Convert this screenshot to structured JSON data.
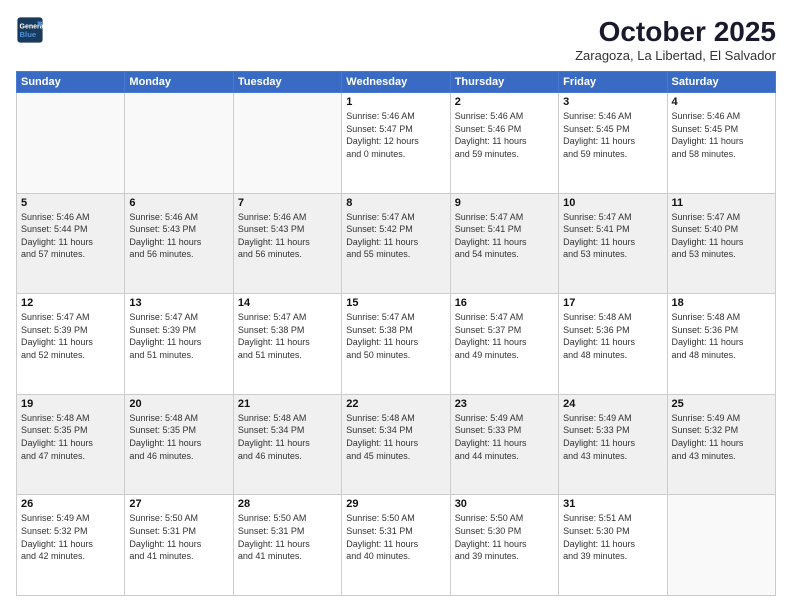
{
  "header": {
    "logo_line1": "General",
    "logo_line2": "Blue",
    "month": "October 2025",
    "location": "Zaragoza, La Libertad, El Salvador"
  },
  "weekdays": [
    "Sunday",
    "Monday",
    "Tuesday",
    "Wednesday",
    "Thursday",
    "Friday",
    "Saturday"
  ],
  "weeks": [
    [
      {
        "day": "",
        "info": ""
      },
      {
        "day": "",
        "info": ""
      },
      {
        "day": "",
        "info": ""
      },
      {
        "day": "1",
        "info": "Sunrise: 5:46 AM\nSunset: 5:47 PM\nDaylight: 12 hours\nand 0 minutes."
      },
      {
        "day": "2",
        "info": "Sunrise: 5:46 AM\nSunset: 5:46 PM\nDaylight: 11 hours\nand 59 minutes."
      },
      {
        "day": "3",
        "info": "Sunrise: 5:46 AM\nSunset: 5:45 PM\nDaylight: 11 hours\nand 59 minutes."
      },
      {
        "day": "4",
        "info": "Sunrise: 5:46 AM\nSunset: 5:45 PM\nDaylight: 11 hours\nand 58 minutes."
      }
    ],
    [
      {
        "day": "5",
        "info": "Sunrise: 5:46 AM\nSunset: 5:44 PM\nDaylight: 11 hours\nand 57 minutes."
      },
      {
        "day": "6",
        "info": "Sunrise: 5:46 AM\nSunset: 5:43 PM\nDaylight: 11 hours\nand 56 minutes."
      },
      {
        "day": "7",
        "info": "Sunrise: 5:46 AM\nSunset: 5:43 PM\nDaylight: 11 hours\nand 56 minutes."
      },
      {
        "day": "8",
        "info": "Sunrise: 5:47 AM\nSunset: 5:42 PM\nDaylight: 11 hours\nand 55 minutes."
      },
      {
        "day": "9",
        "info": "Sunrise: 5:47 AM\nSunset: 5:41 PM\nDaylight: 11 hours\nand 54 minutes."
      },
      {
        "day": "10",
        "info": "Sunrise: 5:47 AM\nSunset: 5:41 PM\nDaylight: 11 hours\nand 53 minutes."
      },
      {
        "day": "11",
        "info": "Sunrise: 5:47 AM\nSunset: 5:40 PM\nDaylight: 11 hours\nand 53 minutes."
      }
    ],
    [
      {
        "day": "12",
        "info": "Sunrise: 5:47 AM\nSunset: 5:39 PM\nDaylight: 11 hours\nand 52 minutes."
      },
      {
        "day": "13",
        "info": "Sunrise: 5:47 AM\nSunset: 5:39 PM\nDaylight: 11 hours\nand 51 minutes."
      },
      {
        "day": "14",
        "info": "Sunrise: 5:47 AM\nSunset: 5:38 PM\nDaylight: 11 hours\nand 51 minutes."
      },
      {
        "day": "15",
        "info": "Sunrise: 5:47 AM\nSunset: 5:38 PM\nDaylight: 11 hours\nand 50 minutes."
      },
      {
        "day": "16",
        "info": "Sunrise: 5:47 AM\nSunset: 5:37 PM\nDaylight: 11 hours\nand 49 minutes."
      },
      {
        "day": "17",
        "info": "Sunrise: 5:48 AM\nSunset: 5:36 PM\nDaylight: 11 hours\nand 48 minutes."
      },
      {
        "day": "18",
        "info": "Sunrise: 5:48 AM\nSunset: 5:36 PM\nDaylight: 11 hours\nand 48 minutes."
      }
    ],
    [
      {
        "day": "19",
        "info": "Sunrise: 5:48 AM\nSunset: 5:35 PM\nDaylight: 11 hours\nand 47 minutes."
      },
      {
        "day": "20",
        "info": "Sunrise: 5:48 AM\nSunset: 5:35 PM\nDaylight: 11 hours\nand 46 minutes."
      },
      {
        "day": "21",
        "info": "Sunrise: 5:48 AM\nSunset: 5:34 PM\nDaylight: 11 hours\nand 46 minutes."
      },
      {
        "day": "22",
        "info": "Sunrise: 5:48 AM\nSunset: 5:34 PM\nDaylight: 11 hours\nand 45 minutes."
      },
      {
        "day": "23",
        "info": "Sunrise: 5:49 AM\nSunset: 5:33 PM\nDaylight: 11 hours\nand 44 minutes."
      },
      {
        "day": "24",
        "info": "Sunrise: 5:49 AM\nSunset: 5:33 PM\nDaylight: 11 hours\nand 43 minutes."
      },
      {
        "day": "25",
        "info": "Sunrise: 5:49 AM\nSunset: 5:32 PM\nDaylight: 11 hours\nand 43 minutes."
      }
    ],
    [
      {
        "day": "26",
        "info": "Sunrise: 5:49 AM\nSunset: 5:32 PM\nDaylight: 11 hours\nand 42 minutes."
      },
      {
        "day": "27",
        "info": "Sunrise: 5:50 AM\nSunset: 5:31 PM\nDaylight: 11 hours\nand 41 minutes."
      },
      {
        "day": "28",
        "info": "Sunrise: 5:50 AM\nSunset: 5:31 PM\nDaylight: 11 hours\nand 41 minutes."
      },
      {
        "day": "29",
        "info": "Sunrise: 5:50 AM\nSunset: 5:31 PM\nDaylight: 11 hours\nand 40 minutes."
      },
      {
        "day": "30",
        "info": "Sunrise: 5:50 AM\nSunset: 5:30 PM\nDaylight: 11 hours\nand 39 minutes."
      },
      {
        "day": "31",
        "info": "Sunrise: 5:51 AM\nSunset: 5:30 PM\nDaylight: 11 hours\nand 39 minutes."
      },
      {
        "day": "",
        "info": ""
      }
    ]
  ]
}
